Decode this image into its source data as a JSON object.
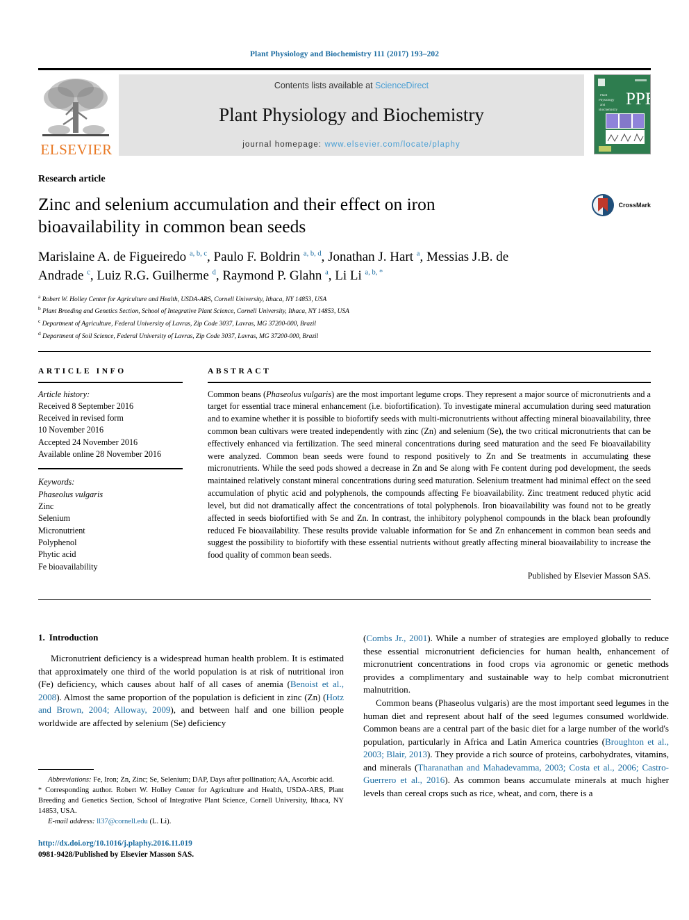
{
  "running_head": "Plant Physiology and Biochemistry 111 (2017) 193–202",
  "masthead": {
    "publisher_name": "ELSEVIER",
    "contents_prefix": "Contents lists available at ",
    "contents_link": "ScienceDirect",
    "journal_name": "Plant Physiology and Biochemistry",
    "homepage_prefix": "journal homepage: ",
    "homepage_url": "www.elsevier.com/locate/plaphy",
    "cover_title": "PPB",
    "cover_subtitle": "Plant Physiology and Biochemistry"
  },
  "article": {
    "type": "Research article",
    "title": "Zinc and selenium accumulation and their effect on iron bioavailability in common bean seeds",
    "crossmark_label": "CrossMark",
    "authors_html": "Marislaine A. de Figueiredo <sup>a, b, c</sup>, Paulo F. Boldrin <sup>a, b, d</sup>, Jonathan J. Hart <sup>a</sup>, Messias J.B. de Andrade <sup>c</sup>, Luiz R.G. Guilherme <sup>d</sup>, Raymond P. Glahn <sup>a</sup>, Li Li <sup>a, b, *</sup>",
    "affiliations": [
      {
        "marker": "a",
        "text": "Robert W. Holley Center for Agriculture and Health, USDA-ARS, Cornell University, Ithaca, NY 14853, USA"
      },
      {
        "marker": "b",
        "text": "Plant Breeding and Genetics Section, School of Integrative Plant Science, Cornell University, Ithaca, NY 14853, USA"
      },
      {
        "marker": "c",
        "text": "Department of Agriculture, Federal University of Lavras, Zip Code 3037, Lavras, MG 37200-000, Brazil"
      },
      {
        "marker": "d",
        "text": "Department of Soil Science, Federal University of Lavras, Zip Code 3037, Lavras, MG 37200-000, Brazil"
      }
    ]
  },
  "article_info": {
    "heading": "ARTICLE INFO",
    "history_label": "Article history:",
    "history_lines": [
      "Received 8 September 2016",
      "Received in revised form",
      "10 November 2016",
      "Accepted 24 November 2016",
      "Available online 28 November 2016"
    ],
    "keywords_label": "Keywords:",
    "keywords": [
      "Phaseolus vulgaris",
      "Zinc",
      "Selenium",
      "Micronutrient",
      "Polyphenol",
      "Phytic acid",
      "Fe bioavailability"
    ],
    "keyword_italic_index": 0
  },
  "abstract": {
    "heading": "ABSTRACT",
    "text_html": "Common beans (<span class=\"ital\">Phaseolus vulgaris</span>) are the most important legume crops. They represent a major source of micronutrients and a target for essential trace mineral enhancement (i.e. biofortification). To investigate mineral accumulation during seed maturation and to examine whether it is possible to biofortify seeds with multi-micronutrients without affecting mineral bioavailability, three common bean cultivars were treated independently with zinc (Zn) and selenium (Se), the two critical micronutrients that can be effectively enhanced via fertilization. The seed mineral concentrations during seed maturation and the seed Fe bioavailability were analyzed. Common bean seeds were found to respond positively to Zn and Se treatments in accumulating these micronutrients. While the seed pods showed a decrease in Zn and Se along with Fe content during pod development, the seeds maintained relatively constant mineral concentrations during seed maturation. Selenium treatment had minimal effect on the seed accumulation of phytic acid and polyphenols, the compounds affecting Fe bioavailability. Zinc treatment reduced phytic acid level, but did not dramatically affect the concentrations of total polyphenols. Iron bioavailability was found not to be greatly affected in seeds biofortified with Se and Zn. In contrast, the inhibitory polyphenol compounds in the black bean profoundly reduced Fe bioavailability. These results provide valuable information for Se and Zn enhancement in common bean seeds and suggest the possibility to biofortify with these essential nutrients without greatly affecting mineral bioavailability to increase the food quality of common bean seeds.",
    "publisher_statement": "Published by Elsevier Masson SAS."
  },
  "introduction": {
    "heading_number": "1.",
    "heading_text": "Introduction",
    "left_paragraph_html": "Micronutrient deficiency is a widespread human health problem. It is estimated that approximately one third of the world population is at risk of nutritional iron (Fe) deficiency, which causes about half of all cases of anemia (<span class=\"ref\">Benoist et al., 2008</span>). Almost the same proportion of the population is deficient in zinc (Zn) (<span class=\"ref\">Hotz and Brown, 2004; Alloway, 2009</span>), and between half and one billion people worldwide are affected by selenium (Se) deficiency",
    "right_paragraph_1_html": "(<span class=\"ref\">Combs Jr., 2001</span>). While a number of strategies are employed globally to reduce these essential micronutrient deficiencies for human health, enhancement of micronutrient concentrations in food crops via agronomic or genetic methods provides a complimentary and sustainable way to help combat micronutrient malnutrition.",
    "right_paragraph_2_html": "Common beans (<span class=\"ital\">Phaseolus vulgaris</span>) are the most important seed legumes in the human diet and represent about half of the seed legumes consumed worldwide. Common beans are a central part of the basic diet for a large number of the world's population, particularly in Africa and Latin America countries (<span class=\"ref\">Broughton et al., 2003; Blair, 2013</span>). They provide a rich source of proteins, carbohydrates, vitamins, and minerals (<span class=\"ref\">Tharanathan and Mahadevamma, 2003; Costa et al., 2006; Castro-Guerrero et al., 2016</span>). As common beans accumulate minerals at much higher levels than cereal crops such as rice, wheat, and corn, there is a"
  },
  "footnotes": {
    "abbreviations_html": "<span class=\"ital\">Abbreviations:</span> Fe, Iron; Zn, Zinc; Se, Selenium; DAP, Days after pollination; AA, Ascorbic acid.",
    "corresponding_html": "<span class=\"star\">*</span> Corresponding author. Robert W. Holley Center for Agriculture and Health, USDA-ARS, Plant Breeding and Genetics Section, School of Integrative Plant Science, Cornell University, Ithaca, NY 14853, USA.",
    "email_html": "<span class=\"ital\">E-mail address:</span> <span class=\"ref\">ll37@cornell.edu</span> (L. Li).",
    "doi": "http://dx.doi.org/10.1016/j.plaphy.2016.11.019",
    "issn_line": "0981-9428/Published by Elsevier Masson SAS."
  },
  "colors": {
    "link_blue": "#1a6ba0",
    "sciencedirect_blue": "#4a9fd4",
    "elsevier_orange": "#E87722",
    "cover_green": "#2e7d4f",
    "band_gray": "#e3e3e3"
  }
}
